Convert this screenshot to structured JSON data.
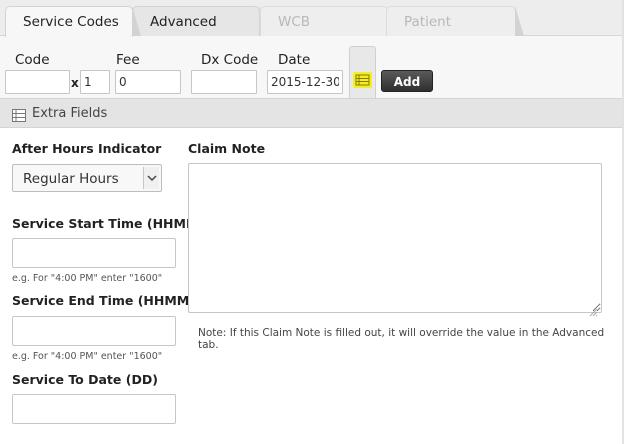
{
  "tabs": [
    {
      "label": "Service Codes",
      "state": "active"
    },
    {
      "label": "Advanced",
      "state": "enabled"
    },
    {
      "label": "WCB",
      "state": "disabled"
    },
    {
      "label": "Patient",
      "state": "disabled"
    }
  ],
  "entry": {
    "code_label": "Code",
    "code_value": "",
    "multiplier_symbol": "x",
    "quantity_value": "1",
    "fee_label": "Fee",
    "fee_value": "0",
    "dx_label": "Dx Code",
    "dx_value": "",
    "date_label": "Date",
    "date_value": "2015-12-30",
    "toggle_icon": "list-icon",
    "add_label": "Add"
  },
  "extra": {
    "header_icon": "list-icon",
    "title": "Extra Fields",
    "after_hours_label": "After Hours Indicator",
    "after_hours_value": "Regular Hours",
    "start_label": "Service Start Time (HHMM)",
    "start_value": "",
    "start_hint": "e.g. For \"4:00 PM\" enter \"1600\"",
    "end_label": "Service End Time (HHMM)",
    "end_value": "",
    "end_hint": "e.g. For \"4:00 PM\" enter \"1600\"",
    "to_date_label": "Service To Date (DD)",
    "to_date_value": "",
    "claim_note_label": "Claim Note",
    "claim_note_value": "",
    "claim_note_hint": "Note: If this Claim Note is filled out, it will override the value in the Advanced tab."
  },
  "colors": {
    "accent_icon": "#f2ee2a",
    "add_button": "#3a3a3a",
    "disabled_text": "#b8b8b8"
  }
}
